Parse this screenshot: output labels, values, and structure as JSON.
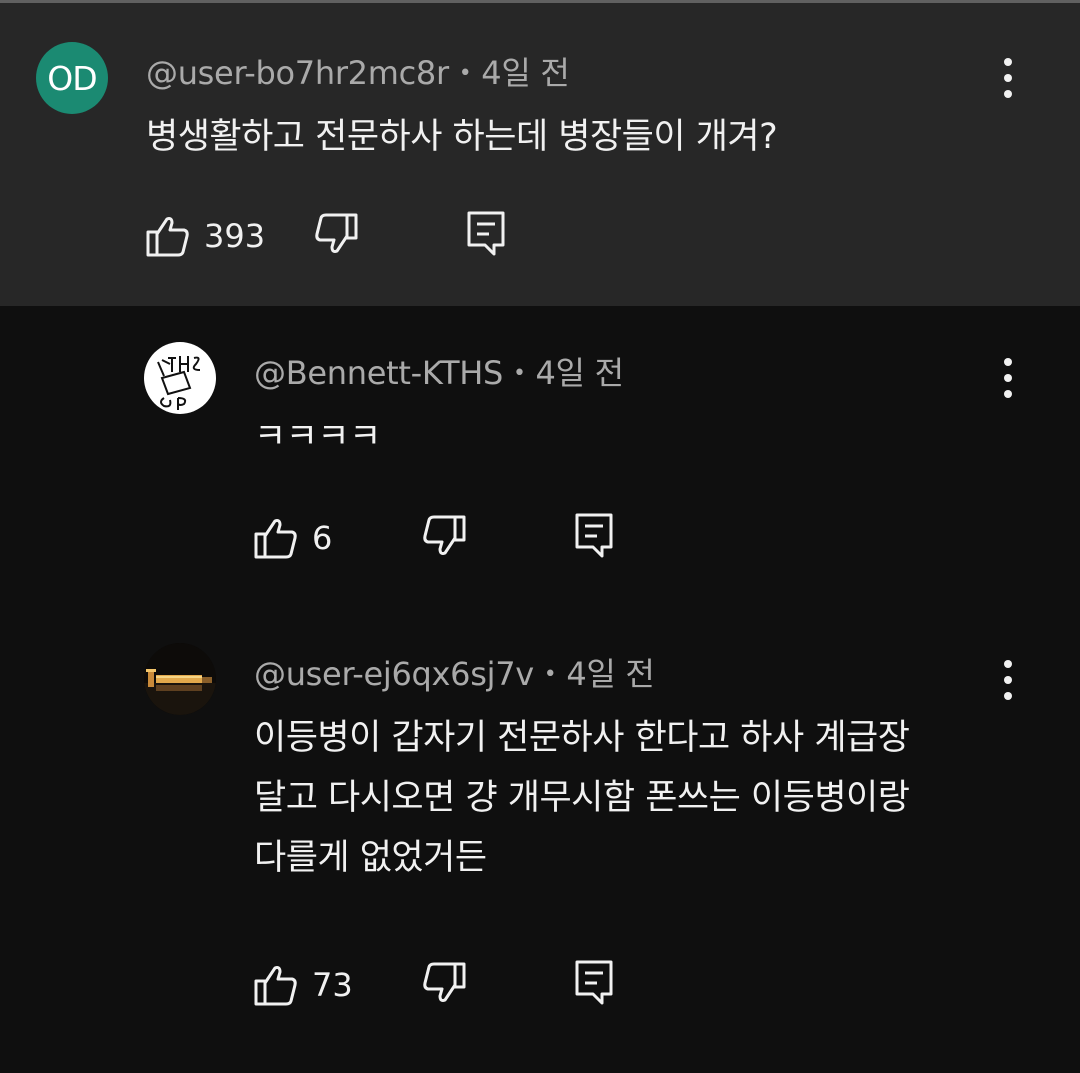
{
  "comments": [
    {
      "avatar_initials": "OD",
      "avatar_color": "#1b8a72",
      "author": "@user-bo7hr2mc8r",
      "separator": "•",
      "time": "4일 전",
      "text_lines": [
        "병생활하고 전문하사 하는데 병장들이 개겨?"
      ],
      "likes": "393"
    },
    {
      "avatar_name": "sketch-avatar",
      "author": "@Bennett-KTHS",
      "separator": "•",
      "time": "4일 전",
      "text_lines": [
        "ㅋㅋㅋㅋ"
      ],
      "likes": "6"
    },
    {
      "avatar_name": "night-photo-avatar",
      "author": "@user-ej6qx6sj7v",
      "separator": "•",
      "time": "4일 전",
      "text_lines": [
        "이등병이 갑자기 전문하사 한다고 하사 계급장",
        "달고 다시오면 걍 개무시함 폰쓰는 이등병이랑",
        "다를게 없었거든"
      ],
      "likes": "73"
    }
  ],
  "icons": {
    "like": "thumbs-up-icon",
    "dislike": "thumbs-down-icon",
    "reply": "reply-icon",
    "more": "more-vert-icon"
  },
  "colors": {
    "highlight_bg": "#272727",
    "page_bg": "#0f0f0f",
    "meta_text": "#aaaaaa"
  }
}
